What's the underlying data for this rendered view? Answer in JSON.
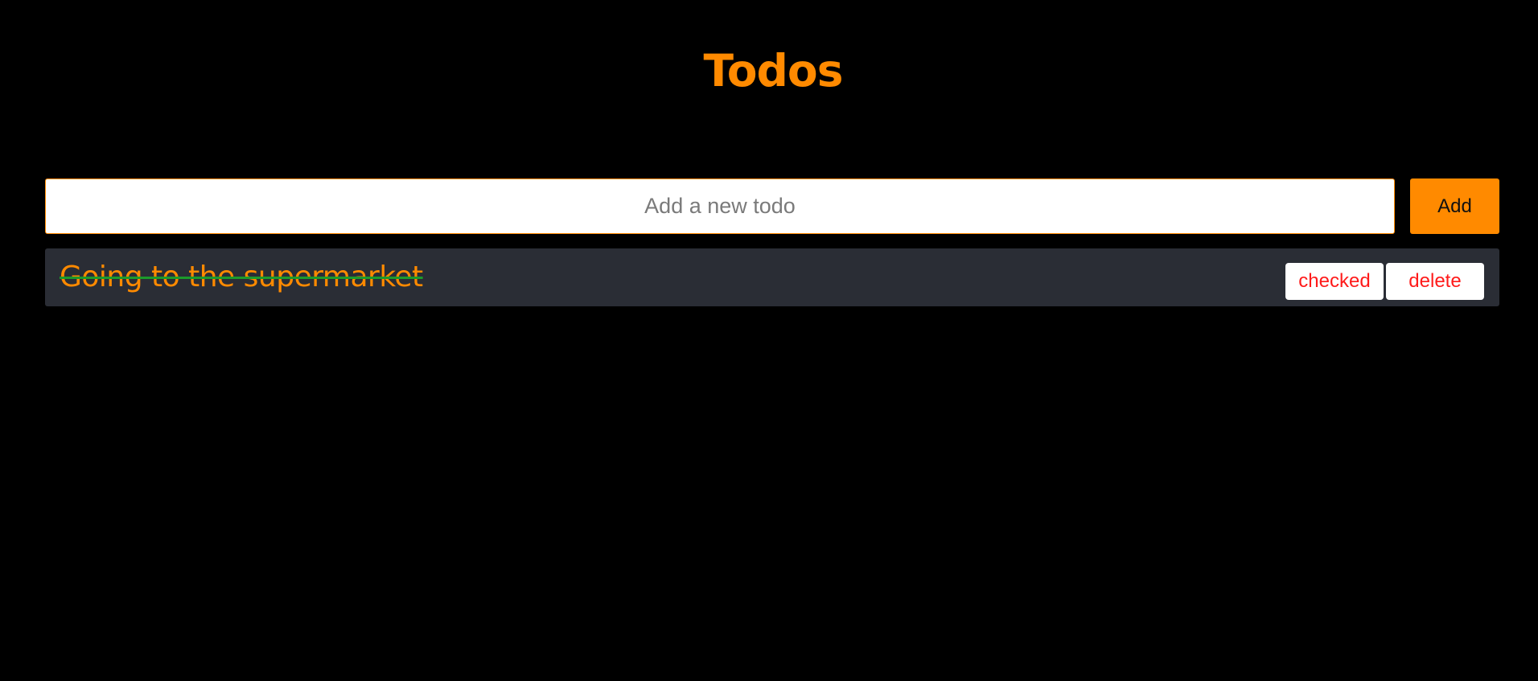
{
  "header": {
    "title": "Todos"
  },
  "form": {
    "input_value": "",
    "input_placeholder": "Add a new todo",
    "add_label": "Add"
  },
  "todos": [
    {
      "text": "Going to the supermarket",
      "completed": true,
      "checked_label": "checked",
      "delete_label": "delete"
    }
  ],
  "colors": {
    "background": "#000000",
    "accent": "#ff8a00",
    "item_background": "#2a2d35",
    "strikethrough": "#1c9a2a",
    "action_text": "#ff1a1a"
  }
}
